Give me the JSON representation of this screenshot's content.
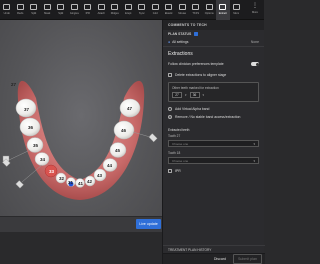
{
  "toolbar": {
    "tools": [
      {
        "label": "Undo",
        "icon": "undo-icon"
      },
      {
        "label": "Redo",
        "icon": "redo-icon"
      },
      {
        "label": "Split",
        "icon": "split-icon"
      },
      {
        "label": "Mask",
        "icon": "mask-icon"
      },
      {
        "label": "Split",
        "icon": "split-icon-2"
      },
      {
        "label": "Gingiva",
        "icon": "gingiva-icon"
      },
      {
        "label": "IPR",
        "icon": "ipr-icon"
      },
      {
        "label": "Attach",
        "icon": "attach-icon"
      },
      {
        "label": "Ridges",
        "icon": "ridges-icon"
      },
      {
        "label": "Erupt",
        "icon": "erupt-icon"
      },
      {
        "label": "Sync",
        "icon": "sync-icon"
      },
      {
        "label": "Grid",
        "icon": "grid-icon"
      },
      {
        "label": "Elastic",
        "icon": "elastic-icon"
      },
      {
        "label": "Mouse",
        "icon": "mouse-icon"
      },
      {
        "label": "TKFS",
        "icon": "tkfs-icon"
      },
      {
        "label": "Options",
        "icon": "options-icon"
      },
      {
        "label": "Extract",
        "icon": "extract-icon"
      },
      {
        "label": "Mem",
        "icon": "mem-icon"
      }
    ],
    "more_label": "More"
  },
  "viewer": {
    "live_update_label": "Live update",
    "tooth_numbers": [
      "27",
      "37",
      "36",
      "35",
      "34",
      "33",
      "32",
      "31",
      "41",
      "42",
      "43",
      "44",
      "45",
      "46",
      "47"
    ]
  },
  "panel": {
    "header": "COMMENTS TO TECH",
    "plan_status": "PLAN STATUS",
    "all_settings": "All settings",
    "none": "None",
    "extractions_title": "Extractions",
    "follow_clinician": "Follow clinician preferences template",
    "delete_extractions": "Delete extractions to aligner stage",
    "other_teeth_label": "Other teeth marked for extraction",
    "tooth_a": "27",
    "tooth_b": "36",
    "add_virtual": "Add Virtual Alpha band",
    "remove_ipr": "Remove / No stable band access/extraction",
    "extracted_teeth": "Extracted teeth",
    "tooth27_label": "Tooth 27",
    "tooth18_label": "Tooth 18",
    "choose_one": "Choose one",
    "ipr_label": "IPR",
    "history": "TREATMENT PLAN HISTORY",
    "discard": "Discard",
    "submit": "Submit plan"
  }
}
